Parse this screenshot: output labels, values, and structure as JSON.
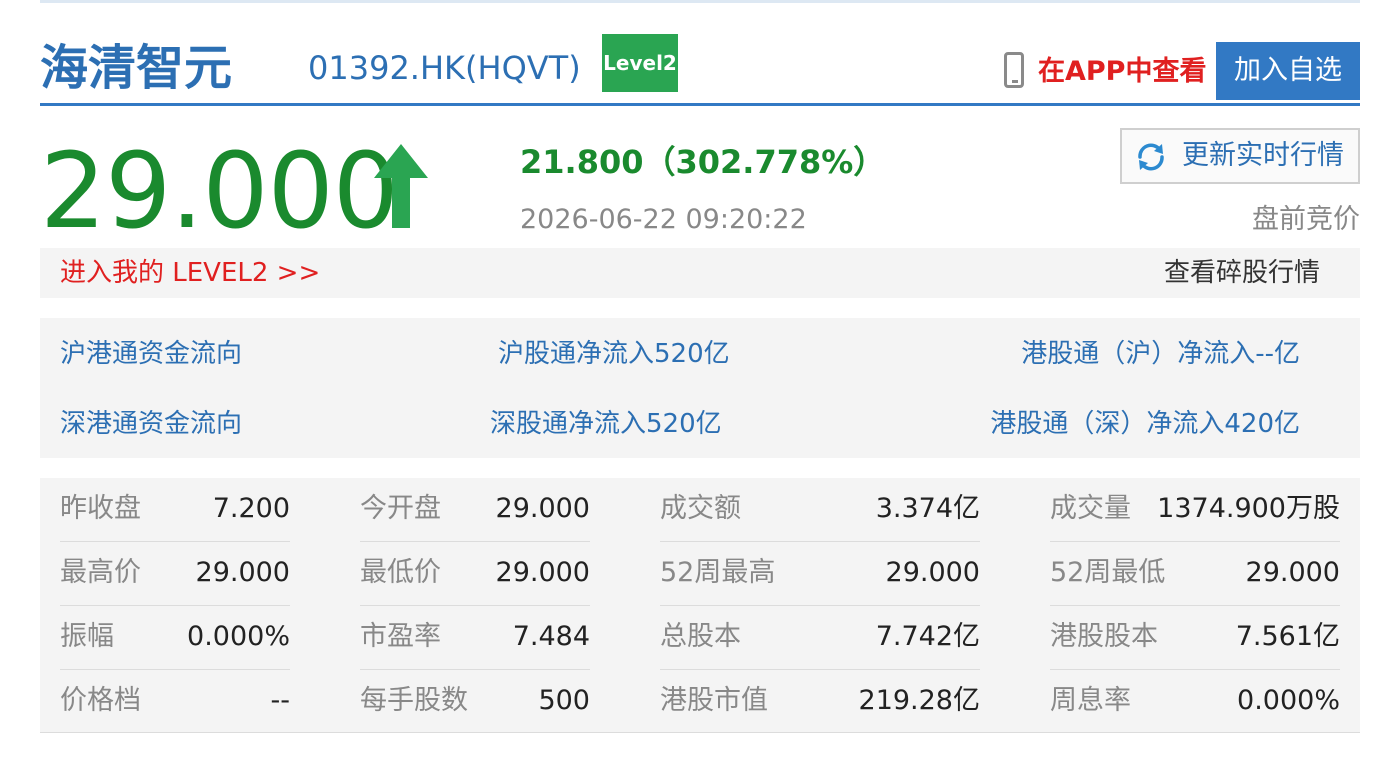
{
  "stock": {
    "name": "海清智元",
    "code": "01392.HK(HQVT)",
    "level_badge": "Level2"
  },
  "header": {
    "app_view_label": "在APP中查看",
    "add_watch_label": "加入自选"
  },
  "quote": {
    "price": "29.000",
    "change": "21.800（302.778%）",
    "timestamp": "2026-06-22 09:20:22",
    "refresh_label": "更新实时行情",
    "session_label": "盘前竞价",
    "up_color": "#1a8a2e"
  },
  "bar": {
    "level2_link": "进入我的 LEVEL2 >>",
    "odd_lot_link": "查看碎股行情"
  },
  "flows": [
    {
      "label": "沪港通资金流向",
      "north": "沪股通净流入520亿",
      "south": "港股通（沪）净流入--亿"
    },
    {
      "label": "深港通资金流向",
      "north": "深股通净流入520亿",
      "south": "港股通（深）净流入420亿"
    }
  ],
  "stats": [
    [
      {
        "label": "昨收盘",
        "value": "7.200"
      },
      {
        "label": "今开盘",
        "value": "29.000"
      },
      {
        "label": "成交额",
        "value": "3.374亿"
      },
      {
        "label": "成交量",
        "value": "1374.900万股"
      }
    ],
    [
      {
        "label": "最高价",
        "value": "29.000"
      },
      {
        "label": "最低价",
        "value": "29.000"
      },
      {
        "label": "52周最高",
        "value": "29.000"
      },
      {
        "label": "52周最低",
        "value": "29.000"
      }
    ],
    [
      {
        "label": "振幅",
        "value": "0.000%"
      },
      {
        "label": "市盈率",
        "value": "7.484"
      },
      {
        "label": "总股本",
        "value": "7.742亿"
      },
      {
        "label": "港股股本",
        "value": "7.561亿"
      }
    ],
    [
      {
        "label": "价格档",
        "value": "--"
      },
      {
        "label": "每手股数",
        "value": "500"
      },
      {
        "label": "港股市值",
        "value": "219.28亿"
      },
      {
        "label": "周息率",
        "value": "0.000%"
      }
    ]
  ]
}
